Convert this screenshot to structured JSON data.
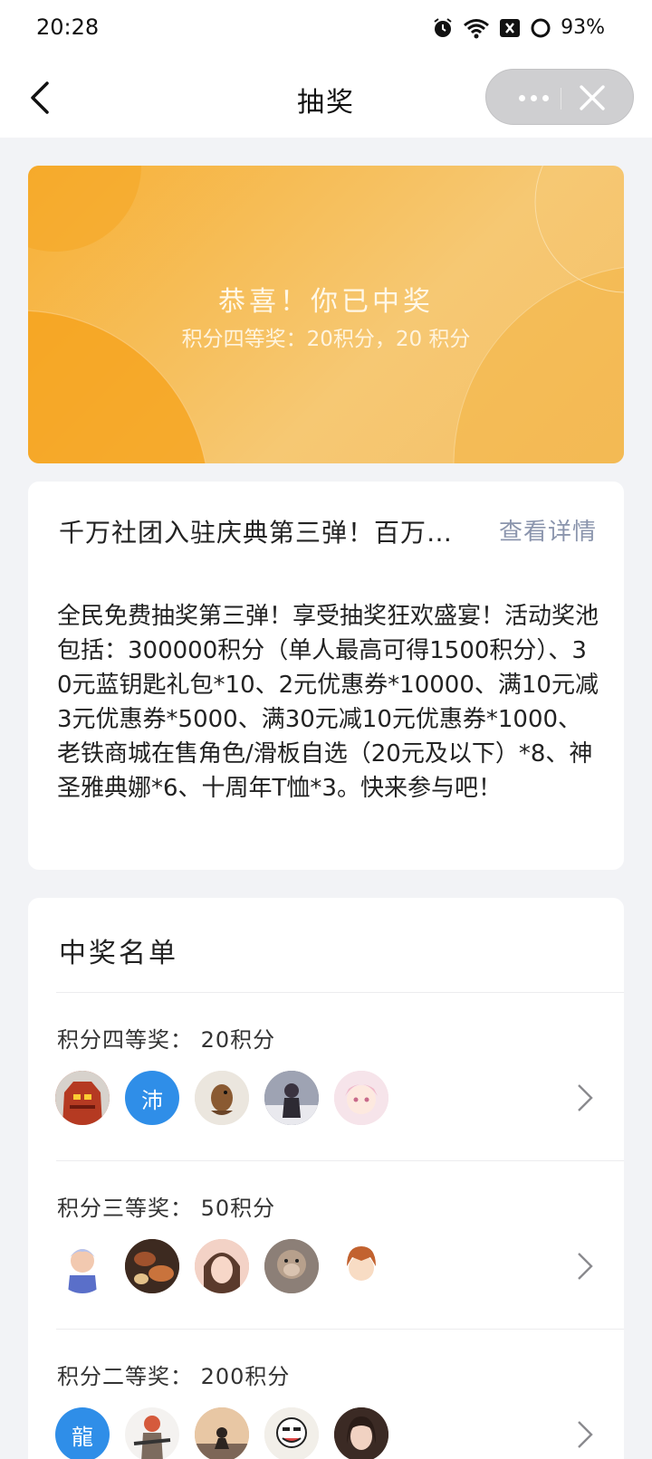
{
  "status_bar": {
    "time": "20:28",
    "battery": "93%"
  },
  "nav": {
    "title": "抽奖"
  },
  "banner": {
    "title": "恭喜！你已中奖",
    "subtitle": "积分四等奖：20积分，20 积分",
    "colors": {
      "start": "#f7b036",
      "end": "#f4c068"
    }
  },
  "activity": {
    "title": "千万社团入驻庆典第三弹！百万积分抽奖",
    "detail_link": "查看详情",
    "description": "全民免费抽奖第三弹！享受抽奖狂欢盛宴！活动奖池包括：300000积分（单人最高可得1500积分）、30元蓝钥匙礼包*10、2元优惠券*10000、满10元减3元优惠券*5000、满30元减10元优惠券*1000、老铁商城在售角色/滑板自选（20元及以下）*8、神圣雅典娜*6、十周年T恤*3。快来参与吧！"
  },
  "winners": {
    "title": "中奖名单",
    "tiers": [
      {
        "label": "积分四等奖：  20积分",
        "avatars": [
          {
            "type": "image",
            "icon": "red-robot-avatar",
            "color": "#c8452b"
          },
          {
            "type": "text",
            "text": "沛",
            "color": "#2f8ee8"
          },
          {
            "type": "image",
            "icon": "bird-avatar",
            "color": "#d8cfc2"
          },
          {
            "type": "image",
            "icon": "girl-photo-avatar",
            "color": "#6d7080"
          },
          {
            "type": "image",
            "icon": "anime-girl-avatar",
            "color": "#f3d7de"
          }
        ]
      },
      {
        "label": "积分三等奖：  50积分",
        "avatars": [
          {
            "type": "image",
            "icon": "cartoon-boy-avatar",
            "color": "#b9c6ea"
          },
          {
            "type": "image",
            "icon": "food-photo-avatar",
            "color": "#6a4330"
          },
          {
            "type": "image",
            "icon": "woman-photo-avatar",
            "color": "#e9b7a3"
          },
          {
            "type": "image",
            "icon": "monkey-meme-avatar",
            "color": "#9a8a80"
          },
          {
            "type": "image",
            "icon": "anime-boy-avatar",
            "color": "#c76b3e"
          }
        ]
      },
      {
        "label": "积分二等奖：  200积分",
        "avatars": [
          {
            "type": "text",
            "text": "龍",
            "color": "#2f8ee8"
          },
          {
            "type": "image",
            "icon": "game-character-avatar",
            "color": "#c9c3bd"
          },
          {
            "type": "image",
            "icon": "sunset-silhouette-avatar",
            "color": "#d9b08a"
          },
          {
            "type": "image",
            "icon": "meme-face-avatar",
            "color": "#e8e4de"
          },
          {
            "type": "image",
            "icon": "woman-selfie-avatar",
            "color": "#5a4036"
          }
        ]
      }
    ]
  }
}
